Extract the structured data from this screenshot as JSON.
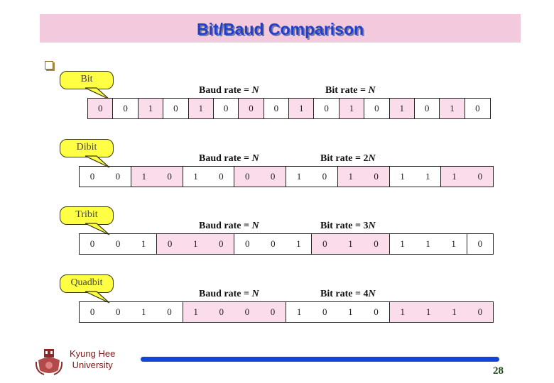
{
  "title": "Bit/Baud Comparison",
  "bullet_icon": "hollow-square-bullet",
  "rows": [
    {
      "label": "Bit",
      "baud_rate_text": "Baud rate = ",
      "baud_rate_var": "N",
      "bit_rate_text": "Bit rate = ",
      "bit_rate_var": "N",
      "bits_per_baud": 1,
      "groups": [
        [
          "0"
        ],
        [
          "0"
        ],
        [
          "1"
        ],
        [
          "0"
        ],
        [
          "1"
        ],
        [
          "0"
        ],
        [
          "0"
        ],
        [
          "0"
        ],
        [
          "1"
        ],
        [
          "0"
        ],
        [
          "1"
        ],
        [
          "0"
        ],
        [
          "1"
        ],
        [
          "0"
        ],
        [
          "1"
        ],
        [
          "0"
        ]
      ],
      "shaded": [
        true,
        false,
        true,
        false,
        true,
        false,
        true,
        false,
        true,
        false,
        true,
        false,
        true,
        false,
        true,
        false
      ]
    },
    {
      "label": "Dibit",
      "baud_rate_text": "Baud rate = ",
      "baud_rate_var": "N",
      "bit_rate_text": "Bit rate = 2",
      "bit_rate_var": "N",
      "bits_per_baud": 2,
      "groups": [
        [
          "0",
          "0"
        ],
        [
          "1",
          "0"
        ],
        [
          "1",
          "0"
        ],
        [
          "0",
          "0"
        ],
        [
          "1",
          "0"
        ],
        [
          "1",
          "0"
        ],
        [
          "1",
          "1"
        ],
        [
          "1",
          "0"
        ]
      ],
      "shaded": [
        false,
        true,
        false,
        true,
        false,
        true,
        false,
        true
      ]
    },
    {
      "label": "Tribit",
      "baud_rate_text": "Baud rate = ",
      "baud_rate_var": "N",
      "bit_rate_text": "Bit rate = 3",
      "bit_rate_var": "N",
      "bits_per_baud": 3,
      "groups": [
        [
          "0",
          "0",
          "1"
        ],
        [
          "0",
          "1",
          "0"
        ],
        [
          "0",
          "0",
          "1"
        ],
        [
          "0",
          "1",
          "0"
        ],
        [
          "1",
          "1",
          "1"
        ],
        [
          "0"
        ]
      ],
      "shaded": [
        false,
        true,
        false,
        true,
        false,
        false
      ]
    },
    {
      "label": "Quadbit",
      "baud_rate_text": "Baud rate = ",
      "baud_rate_var": "N",
      "bit_rate_text": "Bit rate = 4",
      "bit_rate_var": "N",
      "bits_per_baud": 4,
      "groups": [
        [
          "0",
          "0",
          "1",
          "0"
        ],
        [
          "1",
          "0",
          "0",
          "0"
        ],
        [
          "1",
          "0",
          "1",
          "0"
        ],
        [
          "1",
          "1",
          "1",
          "0"
        ]
      ],
      "shaded": [
        false,
        true,
        false,
        true
      ]
    }
  ],
  "footer": {
    "university_line1": "Kyung Hee",
    "university_line2": "University",
    "logo_icon": "university-emblem-icon",
    "page_number": "28"
  },
  "colors": {
    "title_bg": "#f2c9dd",
    "title_text": "#1f3fcf",
    "cell_shade": "#fbdcea",
    "callout_fill": "#ffff44",
    "footer_bar": "#1444d6",
    "university_text": "#7a1a1a"
  }
}
